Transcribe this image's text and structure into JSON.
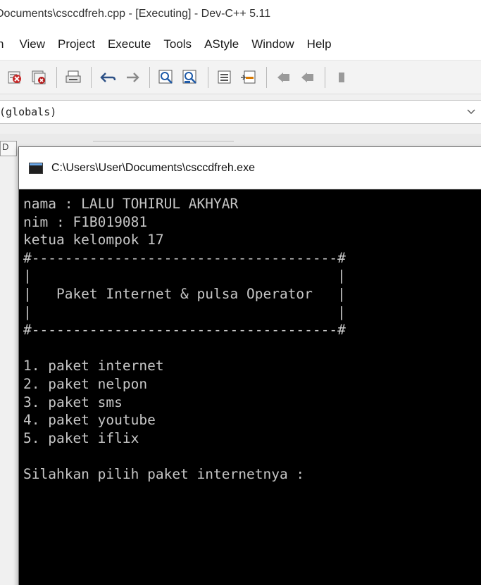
{
  "ide": {
    "window_title": "Documents\\csccdfreh.cpp - [Executing] - Dev-C++ 5.11",
    "menu": [
      "n",
      "View",
      "Project",
      "Execute",
      "Tools",
      "AStyle",
      "Window",
      "Help"
    ],
    "globals_combo": "(globals)",
    "peek_tab_label": "D",
    "toolbar_icons": [
      "close-file-icon",
      "close-all-icon",
      "print-icon",
      "undo-icon",
      "redo-icon",
      "find-icon",
      "replace-icon",
      "toggle-bookmark-icon",
      "goto-bookmark-icon",
      "indent-left-icon",
      "unindent-icon",
      "more-icon"
    ]
  },
  "console": {
    "title": "C:\\Users\\User\\Documents\\csccdfreh.exe",
    "lines": [
      "nama : LALU TOHIRUL AKHYAR",
      "nim : F1B019081",
      "ketua kelompok 17",
      "#-------------------------------------#",
      "|                                     |",
      "|   Paket Internet & pulsa Operator   |",
      "|                                     |",
      "#-------------------------------------#",
      "",
      "1. paket internet",
      "2. paket nelpon",
      "3. paket sms",
      "4. paket youtube",
      "5. paket iflix",
      "",
      "Silahkan pilih paket internetnya :"
    ]
  },
  "colors": {
    "console_bg": "#000000",
    "console_text": "#c6c6c6",
    "title_bar_bg": "#ffffff"
  }
}
